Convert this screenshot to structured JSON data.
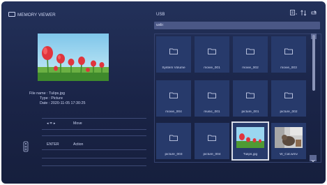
{
  "app": {
    "title": "MEMORY VIEWER"
  },
  "file_info": {
    "name_label": "File name",
    "name_value": "Tulips.jpg",
    "type_label": "Type",
    "type_value": "Picture",
    "date_label": "Date",
    "date_value": "2020-11-05 17:30:25"
  },
  "controls": [
    {
      "key": "◂ ≑ ▸",
      "action": "Move"
    },
    {
      "key": "ENTER",
      "action": "Action"
    }
  ],
  "browser": {
    "location_label": "USB",
    "path": "usb:",
    "items": [
      {
        "label": "System Volume",
        "kind": "folder"
      },
      {
        "label": "movie_001",
        "kind": "folder"
      },
      {
        "label": "movie_002",
        "kind": "folder"
      },
      {
        "label": "movie_003",
        "kind": "folder"
      },
      {
        "label": "movie_004",
        "kind": "folder"
      },
      {
        "label": "music_001",
        "kind": "folder"
      },
      {
        "label": "picture_001",
        "kind": "folder"
      },
      {
        "label": "picture_002",
        "kind": "folder"
      },
      {
        "label": "picture_003",
        "kind": "folder"
      },
      {
        "label": "picture_004",
        "kind": "folder"
      },
      {
        "label": "Tulips.jpg",
        "kind": "image",
        "selected": true
      },
      {
        "label": "W_Cat.wmv",
        "kind": "video"
      }
    ]
  },
  "header_icons": [
    "view-list-icon",
    "sort-icon",
    "repeat-icon"
  ],
  "colors": {
    "background": "#1a2447",
    "tile": "#273a6b",
    "path_bar": "#4a5786",
    "selection": "#d9dde8"
  }
}
